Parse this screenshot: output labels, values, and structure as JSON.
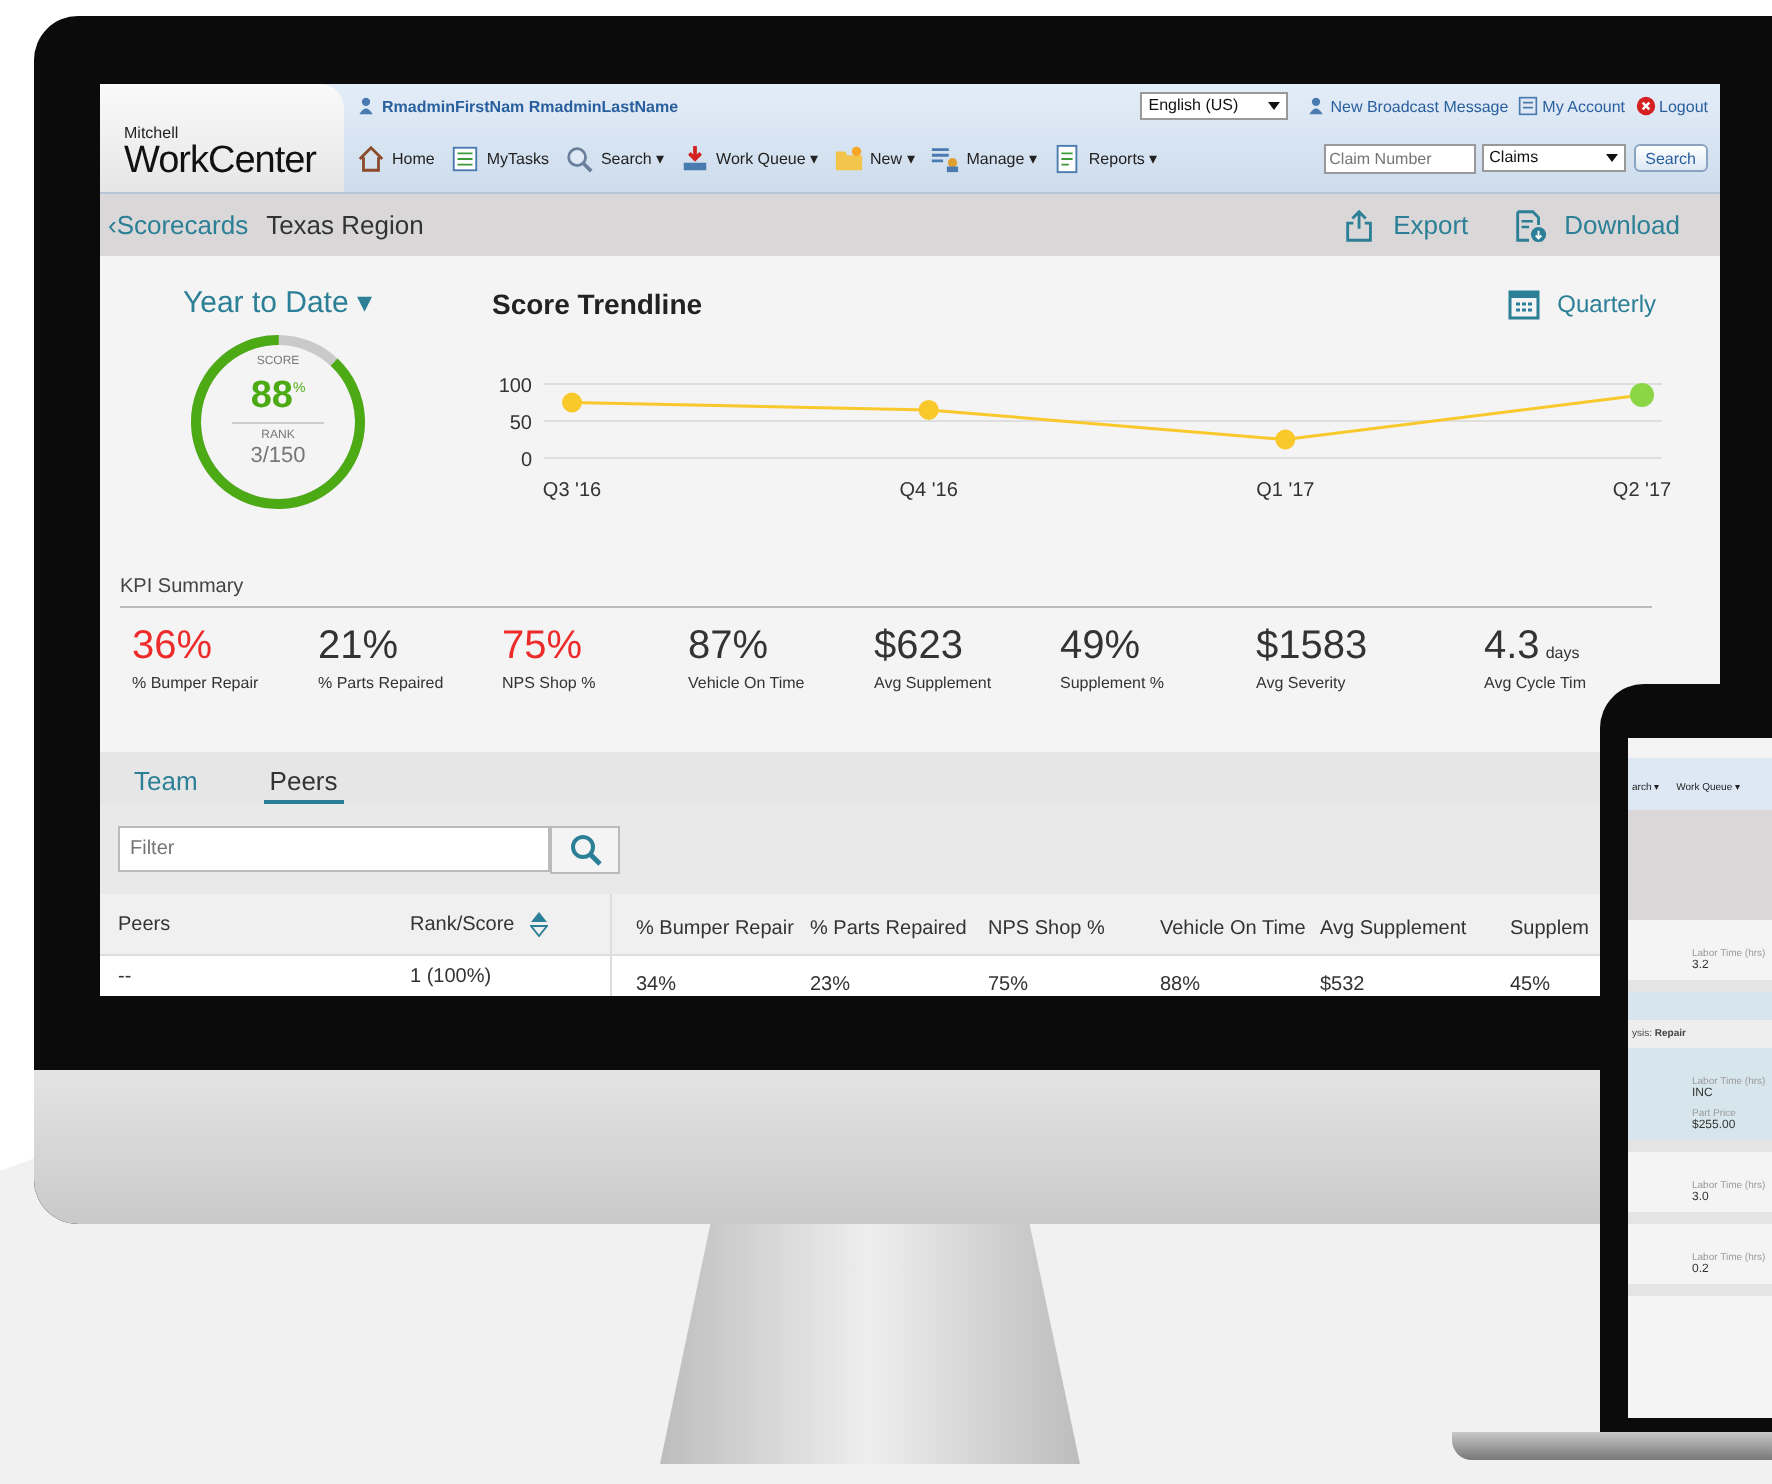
{
  "header": {
    "brand_small": "Mitchell",
    "brand": "WorkCenter",
    "user": "RmadminFirstNam RmadminLastName",
    "language": "English (US)",
    "links": [
      "New Broadcast Message",
      "My Account",
      "Logout"
    ],
    "nav": [
      "Home",
      "MyTasks",
      "Search ▾",
      "Work Queue ▾",
      "New ▾",
      "Manage ▾",
      "Reports ▾"
    ],
    "claim_search": {
      "placeholder": "Claim Number",
      "type": "Claims",
      "button": "Search"
    }
  },
  "breadcrumb": {
    "back": "‹Scorecards",
    "current": "Texas Region",
    "actions": [
      "Export",
      "Download"
    ]
  },
  "score": {
    "period": "Year to Date ▾",
    "score_label": "SCORE",
    "score": "88",
    "unit": "%",
    "rank_label": "RANK",
    "rank": "3/150",
    "level": 0.88
  },
  "trendline": {
    "title": "Score Trendline",
    "interval": "Quarterly",
    "chart_data": {
      "type": "line",
      "categories": [
        "Q3 '16",
        "Q4 '16",
        "Q1 '17",
        "Q2 '17"
      ],
      "series": [
        {
          "color": "#f9c82b",
          "marker": true,
          "values": [
            75,
            65,
            25,
            85
          ]
        }
      ],
      "ylim": [
        0,
        100
      ],
      "yticks": [
        0,
        50,
        100
      ]
    }
  },
  "kpi": {
    "title": "KPI Summary",
    "items": [
      {
        "value": "36%",
        "label": "% Bumper Repair",
        "alert": true
      },
      {
        "value": "21%",
        "label": "% Parts Repaired",
        "alert": false
      },
      {
        "value": "75%",
        "label": "NPS Shop %",
        "alert": true
      },
      {
        "value": "87%",
        "label": "Vehicle On Time",
        "alert": false
      },
      {
        "value": "$623",
        "label": "Avg Supplement",
        "alert": false
      },
      {
        "value": "49%",
        "label": "Supplement %",
        "alert": false
      },
      {
        "value": "$1583",
        "label": "Avg Severity",
        "alert": false
      },
      {
        "value": "4.3",
        "unit": "days",
        "label": "Avg Cycle Tim",
        "alert": false
      }
    ]
  },
  "tabs": [
    {
      "label": "Team",
      "selected": false
    },
    {
      "label": "Peers",
      "selected": true
    }
  ],
  "filter": {
    "placeholder": "Filter"
  },
  "table": {
    "columns": [
      {
        "label": "Peers",
        "sorted": false
      },
      {
        "label": "Rank/Score",
        "sorted": true
      },
      {
        "label": "% Bumper Repair",
        "sorted": false
      },
      {
        "label": "% Parts Repaired",
        "sorted": false
      },
      {
        "label": "NPS Shop %",
        "sorted": false
      },
      {
        "label": "Vehicle On Time",
        "sorted": false
      },
      {
        "label": "Avg Supplement",
        "sorted": false
      },
      {
        "label": "Supplem",
        "sorted": false
      }
    ],
    "rows": [
      [
        "--",
        "1 (100%)",
        "34%",
        "23%",
        "75%",
        "88%",
        "$532",
        "45%"
      ]
    ]
  },
  "laptop": {
    "nav": [
      "arch ▾",
      "Work Queue ▾"
    ],
    "section": "ysis: **Repair**",
    "fields": [
      {
        "label": "Labor Time (hrs)",
        "value": "3.2",
        "highlight": false
      },
      {
        "label": "Labor Time (hrs)",
        "value": "INC",
        "extra_label": "Part Price",
        "extra_value": "$255.00",
        "highlight": true
      },
      {
        "label": "Labor Time (hrs)",
        "value": "3.0",
        "highlight": false
      },
      {
        "label": "Labor Time (hrs)",
        "value": "0.2",
        "highlight": false
      }
    ]
  }
}
